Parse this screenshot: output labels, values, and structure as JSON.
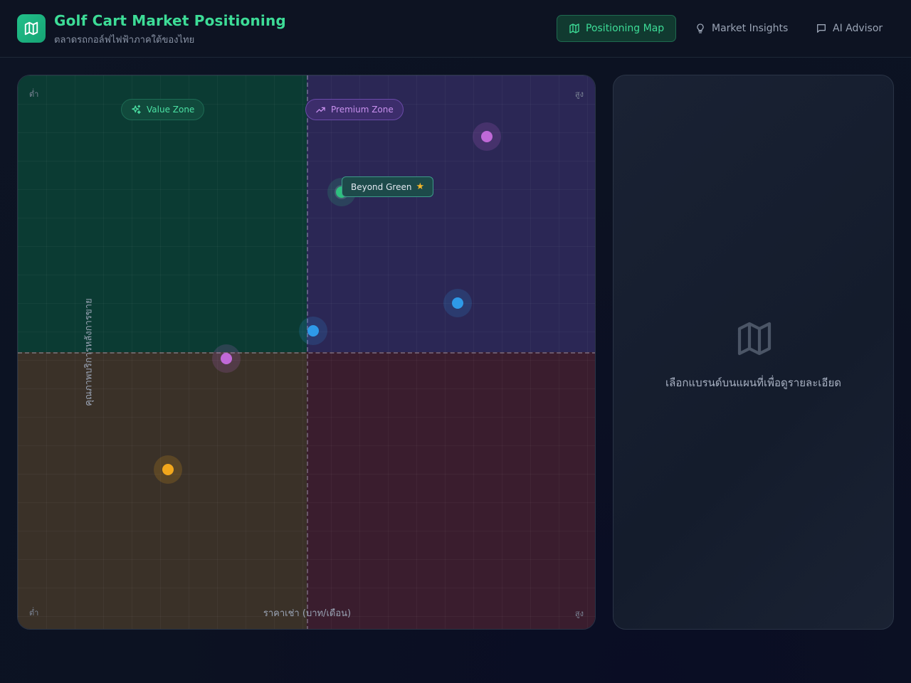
{
  "header": {
    "title": "Golf Cart Market Positioning",
    "subtitle": "ตลาดรถกอล์ฟไฟฟ้าภาคใต้ของไทย",
    "logo_icon": "map-icon",
    "nav": [
      {
        "label": "Positioning Map",
        "icon": "map-icon",
        "active": true
      },
      {
        "label": "Market Insights",
        "icon": "lightbulb-icon",
        "active": false
      },
      {
        "label": "AI Advisor",
        "icon": "chat-bubble-icon",
        "active": false
      }
    ]
  },
  "map": {
    "corners": {
      "top_left": "ต่ำ",
      "top_right": "สูง",
      "bottom_left": "ต่ำ",
      "bottom_right": "สูง"
    },
    "zones": {
      "value": {
        "label": "Value Zone",
        "icon": "sparkles-icon",
        "color": "#4be0a3"
      },
      "premium": {
        "label": "Premium Zone",
        "icon": "trending-up-icon",
        "color": "#c890ee"
      }
    },
    "x_axis_label": "ราคาเช่า (บาท/เดือน)",
    "y_axis_label": "คุณภาพบริการหลังการขาย",
    "highlighted_brand": {
      "label": "Beyond Green",
      "icon": "star-icon"
    },
    "quadrant_colors": {
      "top_left": "#0b3b33",
      "top_right": "#2b2755",
      "bottom_left": "#3a3128",
      "bottom_right": "#3a1d2e"
    },
    "brand_points": [
      {
        "price": 0.56,
        "quality": 0.79,
        "color": "#2fc07f",
        "highlighted": true
      },
      {
        "price": 0.81,
        "quality": 0.89,
        "color": "#c06ad8"
      },
      {
        "price": 0.76,
        "quality": 0.59,
        "color": "#2f9ae8"
      },
      {
        "price": 0.51,
        "quality": 0.54,
        "color": "#2f9ae8"
      },
      {
        "price": 0.36,
        "quality": 0.49,
        "color": "#c06ad8"
      },
      {
        "price": 0.26,
        "quality": 0.29,
        "color": "#f2a81d"
      }
    ]
  },
  "detail": {
    "icon": "map-icon",
    "hint": "เลือกแบรนด์บนแผนที่เพื่อดูรายละเอียด"
  }
}
